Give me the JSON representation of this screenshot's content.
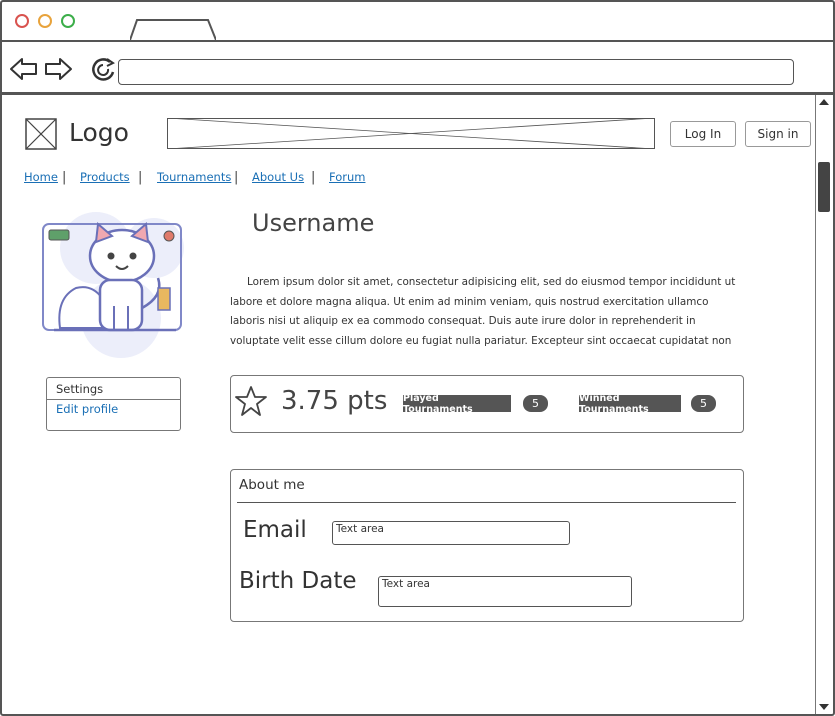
{
  "browser": {
    "icons": {
      "back": "arrow-left-icon",
      "forward": "arrow-right-icon",
      "reload": "reload-icon"
    },
    "dot_colors": [
      "#d9534f",
      "#e8a33c",
      "#3cae4a"
    ]
  },
  "header": {
    "logo_text": "Logo",
    "login_label": "Log In",
    "signin_label": "Sign in"
  },
  "menu": {
    "items": [
      "Home",
      "Products",
      "Tournaments",
      "About Us",
      "Forum"
    ],
    "link_color": "#1a6fb5"
  },
  "profile": {
    "username": "Username",
    "bio": "Lorem ipsum dolor sit amet, consectetur adipisicing elit, sed do eiusmod tempor incididunt ut labore et dolore magna aliqua. Ut enim ad minim veniam, quis nostrud exercitation ullamco laboris nisi ut aliquip ex ea commodo consequat. Duis aute irure dolor in reprehenderit in voluptate velit esse cillum dolore eu fugiat nulla pariatur. Excepteur sint occaecat cupidatat non proident, sunt in culpa"
  },
  "settings": {
    "title": "Settings",
    "link": "Edit profile"
  },
  "stats": {
    "points": "3.75 pts",
    "played_label": "Played Tournaments",
    "played_count": "5",
    "won_label": "Winned Tournaments",
    "won_count": "5"
  },
  "about": {
    "title": "About me",
    "email_label": "Email",
    "email_value": "Text area",
    "birth_label": "Birth Date",
    "birth_value": "Text area"
  }
}
